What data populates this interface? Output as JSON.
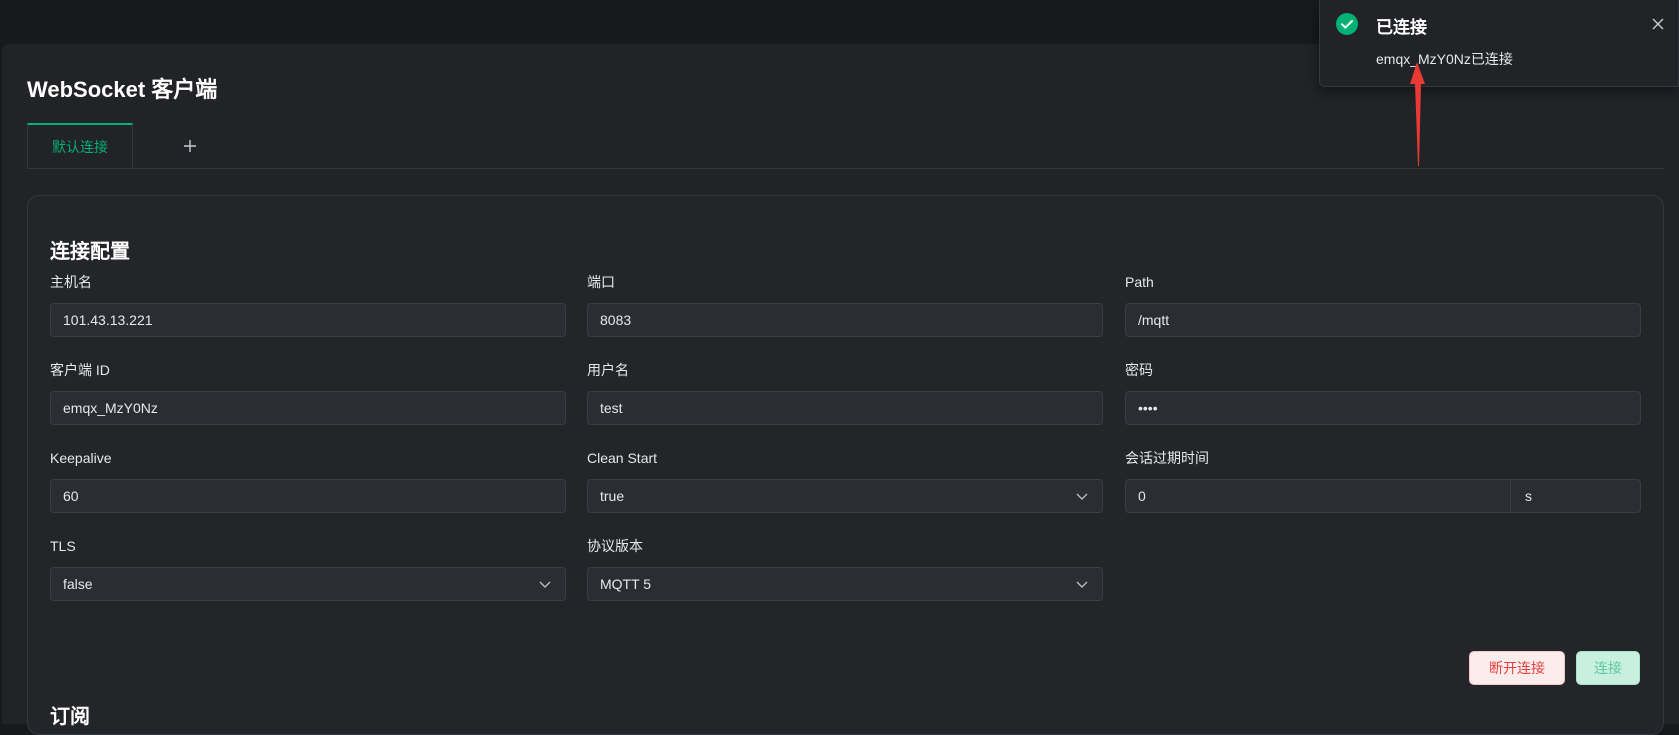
{
  "page_title": "WebSocket 客户端",
  "tabs": [
    {
      "label": "默认连接",
      "active": true
    }
  ],
  "add_tab_icon": "plus-icon",
  "config": {
    "section_title": "连接配置",
    "fields": {
      "host": {
        "label": "主机名",
        "value": "101.43.13.221"
      },
      "port": {
        "label": "端口",
        "value": "8083"
      },
      "path": {
        "label": "Path",
        "value": "/mqtt"
      },
      "client_id": {
        "label": "客户端 ID",
        "value": "emqx_MzY0Nz"
      },
      "username": {
        "label": "用户名",
        "value": "test"
      },
      "password": {
        "label": "密码",
        "value": "••••"
      },
      "keepalive": {
        "label": "Keepalive",
        "value": "60"
      },
      "clean_start": {
        "label": "Clean Start",
        "value": "true"
      },
      "session_expiry": {
        "label": "会话过期时间",
        "value": "0",
        "unit": "s"
      },
      "tls": {
        "label": "TLS",
        "value": "false"
      },
      "protocol_version": {
        "label": "协议版本",
        "value": "MQTT 5"
      }
    },
    "disconnect_label": "断开连接",
    "connect_label": "连接"
  },
  "subscription": {
    "section_title": "订阅"
  },
  "toast": {
    "title": "已连接",
    "message": "emqx_MzY0Nz已连接",
    "icon": "check-circle-icon",
    "close_icon": "close-icon"
  },
  "colors": {
    "accent": "#00b173",
    "background": "#212327",
    "danger": "#e2423f",
    "annotation_arrow": "#e83a35"
  }
}
